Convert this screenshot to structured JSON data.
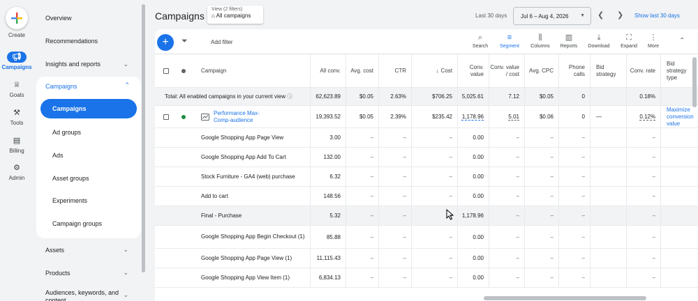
{
  "rail": {
    "create": "Create",
    "items": [
      {
        "label": "Campaigns",
        "icon": "megaphone-icon"
      },
      {
        "label": "Goals",
        "icon": "trophy-icon"
      },
      {
        "label": "Tools",
        "icon": "tools-icon"
      },
      {
        "label": "Billing",
        "icon": "card-icon"
      },
      {
        "label": "Admin",
        "icon": "gear-icon"
      }
    ]
  },
  "nav": {
    "overview": "Overview",
    "recommendations": "Recommendations",
    "insights": "Insights and reports",
    "campaigns": "Campaigns",
    "sub": [
      "Campaigns",
      "Ad groups",
      "Ads",
      "Asset groups",
      "Experiments",
      "Campaign groups"
    ],
    "assets": "Assets",
    "products": "Products",
    "audiences": "Audiences, keywords, and content"
  },
  "header": {
    "title": "Campaigns",
    "view_top": "View (2 filters)",
    "view_bottom": "All campaigns",
    "last30": "Last 30 days",
    "date_range": "Jul 6 – Aug 4, 2026",
    "show30": "Show last 30 days"
  },
  "toolbar": {
    "add_filter": "Add filter",
    "tools": [
      "Search",
      "Segment",
      "Columns",
      "Reports",
      "Download",
      "Expand",
      "More"
    ]
  },
  "table": {
    "headers": {
      "campaign": "Campaign",
      "all_conv": "All conv.",
      "avg_cost": "Avg. cost",
      "ctr": "CTR",
      "cost": "Cost",
      "conv_value": "Conv. value",
      "conv_value_cost": "Conv. value / cost",
      "avg_cpc": "Avg. CPC",
      "phone_calls": "Phone calls",
      "bid_strategy": "Bid strategy",
      "conv_rate": "Conv. rate",
      "bid_strategy_type": "Bid strategy type"
    },
    "total": {
      "label": "Total: All enabled campaigns in your current view",
      "all_conv": "62,623.89",
      "avg_cost": "$0.05",
      "ctr": "2.63%",
      "cost": "$706.25",
      "conv_value": "5,025.61",
      "conv_value_cost": "7.12",
      "avg_cpc": "$0.05",
      "phone_calls": "0",
      "conv_rate": "0.18%"
    },
    "campaign_row": {
      "name": "Performance Max-Comp-audience",
      "all_conv": "19,393.52",
      "avg_cost": "$0.05",
      "ctr": "2.39%",
      "cost": "$235.42",
      "conv_value": "1,178.96",
      "conv_value_cost": "5.01",
      "avg_cpc": "$0.06",
      "phone_calls": "0",
      "bid_strategy": "—",
      "conv_rate": "0.12%",
      "bid_strategy_type": "Maximize conversion value"
    },
    "segments": [
      {
        "name": "Google Shopping App Page View",
        "all_conv": "3.00",
        "conv_value": "0.00"
      },
      {
        "name": "Google Shopping App Add To Cart",
        "all_conv": "132.00",
        "conv_value": "0.00"
      },
      {
        "name": "Stock Furniture - GA4 (web) purchase",
        "all_conv": "6.32",
        "conv_value": "0.00"
      },
      {
        "name": "Add to cart",
        "all_conv": "148.56",
        "conv_value": "0.00"
      },
      {
        "name": "Final - Purchase",
        "all_conv": "5.32",
        "conv_value": "1,178.96"
      },
      {
        "name": "Google Shopping App Begin Checkout (1)",
        "all_conv": "85.88",
        "conv_value": "0.00"
      },
      {
        "name": "Google Shopping App Page View (1)",
        "all_conv": "11,115.43",
        "conv_value": "0.00"
      },
      {
        "name": "Google Shopping App View Item (1)",
        "all_conv": "6,834.13",
        "conv_value": "0.00"
      }
    ],
    "dash": "–"
  }
}
